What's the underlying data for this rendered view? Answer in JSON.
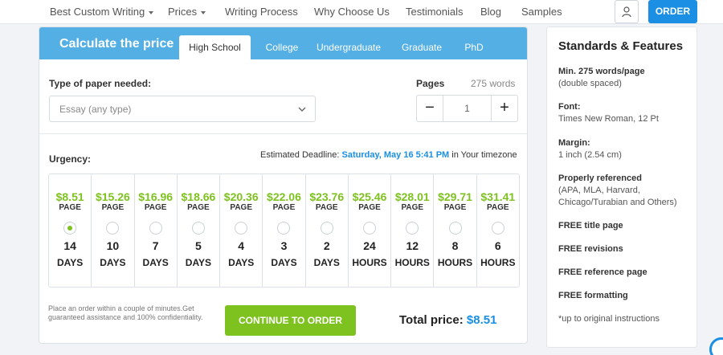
{
  "nav": {
    "items": [
      "Best Custom Writing",
      "Prices",
      "Writing Process",
      "Why Choose Us",
      "Testimonials",
      "Blog",
      "Samples"
    ],
    "order_label": "ORDER",
    "user_icon": "user-icon"
  },
  "calculator": {
    "title": "Calculate the price",
    "tabs": [
      "High School",
      "College",
      "Undergraduate",
      "Graduate",
      "PhD"
    ],
    "active_tab": "High School",
    "paper_label": "Type of paper needed:",
    "paper_value": "Essay (any type)",
    "pages_label": "Pages",
    "words_label": "275 words",
    "pages_value": "1",
    "minus": "−",
    "plus": "+",
    "urgency_label": "Urgency:",
    "deadline_prefix": "Estimated Deadline:",
    "deadline_date": "Saturday, May 16 5:41 PM",
    "deadline_suffix": "in Your timezone",
    "options": [
      {
        "price": "$8.51",
        "per": "PAGE",
        "num": "14",
        "unit": "DAYS",
        "selected": true
      },
      {
        "price": "$15.26",
        "per": "PAGE",
        "num": "10",
        "unit": "DAYS",
        "selected": false
      },
      {
        "price": "$16.96",
        "per": "PAGE",
        "num": "7",
        "unit": "DAYS",
        "selected": false
      },
      {
        "price": "$18.66",
        "per": "PAGE",
        "num": "5",
        "unit": "DAYS",
        "selected": false
      },
      {
        "price": "$20.36",
        "per": "PAGE",
        "num": "4",
        "unit": "DAYS",
        "selected": false
      },
      {
        "price": "$22.06",
        "per": "PAGE",
        "num": "3",
        "unit": "DAYS",
        "selected": false
      },
      {
        "price": "$23.76",
        "per": "PAGE",
        "num": "2",
        "unit": "DAYS",
        "selected": false
      },
      {
        "price": "$25.46",
        "per": "PAGE",
        "num": "24",
        "unit": "HOURS",
        "selected": false
      },
      {
        "price": "$28.01",
        "per": "PAGE",
        "num": "12",
        "unit": "HOURS",
        "selected": false
      },
      {
        "price": "$29.71",
        "per": "PAGE",
        "num": "8",
        "unit": "HOURS",
        "selected": false
      },
      {
        "price": "$31.41",
        "per": "PAGE",
        "num": "6",
        "unit": "HOURS",
        "selected": false
      }
    ],
    "note": "Place an order within a couple of minutes.Get guaranteed assistance and 100% confidentiality.",
    "cta_label": "CONTINUE TO ORDER",
    "total_label": "Total price:",
    "total_value": "$8.51"
  },
  "standards": {
    "title": "Standards & Features",
    "blocks": [
      {
        "bold": "Min. 275 words/page",
        "text": "(double spaced)"
      },
      {
        "bold": "Font:",
        "text": "Times New Roman, 12 Pt"
      },
      {
        "bold": "Margin:",
        "text": "1 inch (2.54 cm)"
      },
      {
        "bold": "Properly referenced",
        "text": "(APA, MLA, Harvard, Chicago/Turabian and Others)"
      }
    ],
    "free": [
      "FREE title page",
      "FREE revisions",
      "FREE reference page",
      "FREE formatting"
    ],
    "footnote": "*up to original instructions"
  },
  "colors": {
    "accent": "#1a8fe3",
    "header": "#53afe4",
    "green": "#7dc21e"
  }
}
